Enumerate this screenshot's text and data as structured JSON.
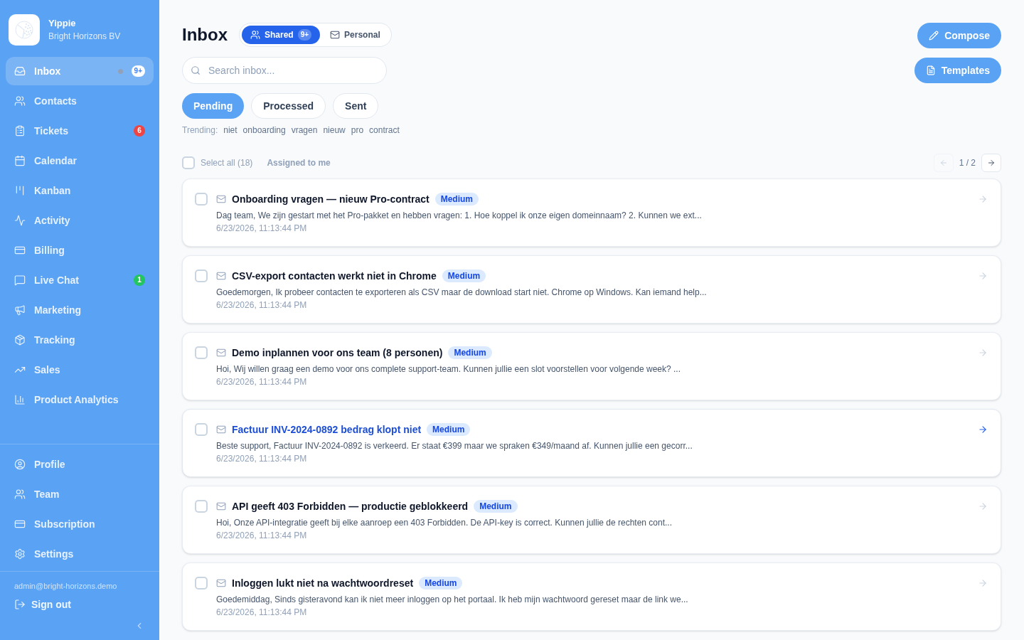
{
  "sidebar": {
    "brand": {
      "name": "Yippie",
      "organization": "Bright Horizons BV"
    },
    "nav": [
      {
        "label": "Inbox",
        "selected": true,
        "dot": true,
        "badge": {
          "text": "9+",
          "color": "#ffffff"
        }
      },
      {
        "label": "Contacts",
        "selected": false,
        "dot": false
      },
      {
        "label": "Tickets",
        "selected": false,
        "dot": false,
        "badge": {
          "text": "6",
          "color": "#ef4444"
        }
      },
      {
        "label": "Calendar",
        "selected": false,
        "dot": false
      },
      {
        "label": "Kanban",
        "selected": false,
        "dot": false
      },
      {
        "label": "Activity",
        "selected": false,
        "dot": false
      },
      {
        "label": "Billing",
        "selected": false,
        "dot": false
      },
      {
        "label": "Live Chat",
        "selected": false,
        "dot": false,
        "badge": {
          "text": "1",
          "color": "#22c55e"
        }
      },
      {
        "label": "Marketing",
        "selected": false,
        "dot": false
      },
      {
        "label": "Tracking",
        "selected": false,
        "dot": false
      },
      {
        "label": "Sales",
        "selected": false,
        "dot": false
      },
      {
        "label": "Product Analytics",
        "selected": false,
        "dot": false
      }
    ],
    "account_nav": [
      {
        "label": "Profile",
        "selected": false
      },
      {
        "label": "Team",
        "selected": false
      },
      {
        "label": "Subscription",
        "selected": false
      },
      {
        "label": "Settings",
        "selected": false
      }
    ],
    "user_email": "admin@bright-horizons.demo",
    "sign_out": "Sign out"
  },
  "header": {
    "title": "Inbox",
    "views": [
      {
        "label": "Shared",
        "selected": true,
        "count": "9+"
      },
      {
        "label": "Personal",
        "selected": false
      }
    ]
  },
  "search": {
    "placeholder": "Search inbox..."
  },
  "actions": {
    "compose": "Compose",
    "templates": "Templates"
  },
  "tabs": [
    {
      "label": "Pending",
      "selected": true
    },
    {
      "label": "Processed",
      "selected": false
    },
    {
      "label": "Sent",
      "selected": false
    }
  ],
  "trending": {
    "label": "Trending:",
    "terms": [
      "niet",
      "onboarding",
      "vragen",
      "nieuw",
      "pro",
      "contract"
    ]
  },
  "toolbar": {
    "select_all": {
      "label": "Select all (18)",
      "checked": false
    },
    "assigned": {
      "label": "Assigned to me",
      "selected": false
    },
    "pagination": {
      "page": "1 / 2",
      "prev_disabled": true,
      "next_disabled": false
    }
  },
  "messages": [
    {
      "subject": "Onboarding vragen — nieuw Pro-contract",
      "priority": "Medium",
      "preview": "Dag team, We zijn gestart met het Pro-pakket en hebben vragen: 1. Hoe koppel ik onze eigen domeinnaam? 2. Kunnen we ext...",
      "date": "6/23/2026, 11:13:44 PM",
      "checked": false,
      "hovered": false
    },
    {
      "subject": "CSV-export contacten werkt niet in Chrome",
      "priority": "Medium",
      "preview": "Goedemorgen, Ik probeer contacten te exporteren als CSV maar de download start niet. Chrome op Windows. Kan iemand help...",
      "date": "6/23/2026, 11:13:44 PM",
      "checked": false,
      "hovered": false
    },
    {
      "subject": "Demo inplannen voor ons team (8 personen)",
      "priority": "Medium",
      "preview": "Hoi, Wij willen graag een demo voor ons complete support-team. Kunnen jullie een slot voorstellen voor volgende week? ...",
      "date": "6/23/2026, 11:13:44 PM",
      "checked": false,
      "hovered": false
    },
    {
      "subject": "Factuur INV-2024-0892 bedrag klopt niet",
      "priority": "Medium",
      "preview": "Beste support, Factuur INV-2024-0892 is verkeerd. Er staat €399 maar we spraken €349/maand af. Kunnen jullie een gecorr...",
      "date": "6/23/2026, 11:13:44 PM",
      "checked": false,
      "hovered": true
    },
    {
      "subject": "API geeft 403 Forbidden — productie geblokkeerd",
      "priority": "Medium",
      "preview": "Hoi, Onze API-integratie geeft bij elke aanroep een 403 Forbidden. De API-key is correct. Kunnen jullie de rechten cont...",
      "date": "6/23/2026, 11:13:44 PM",
      "checked": false,
      "hovered": false
    },
    {
      "subject": "Inloggen lukt niet na wachtwoordreset",
      "priority": "Medium",
      "preview": "Goedemiddag, Sinds gisteravond kan ik niet meer inloggen op het portaal. Ik heb mijn wachtwoord gereset maar de link we...",
      "date": "6/23/2026, 11:13:44 PM",
      "checked": false,
      "hovered": false
    }
  ]
}
